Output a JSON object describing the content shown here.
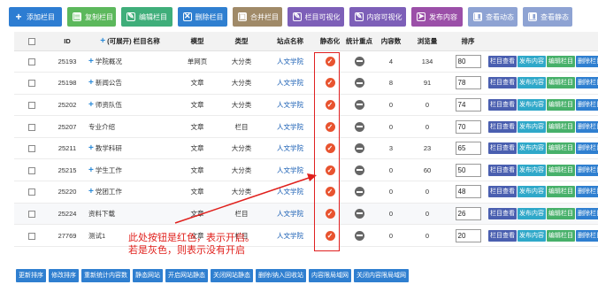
{
  "toolbar": [
    {
      "label": "添加栏目",
      "icon": "plus-icon",
      "glyph": "+",
      "color": "#2d7dd2",
      "w": 60
    },
    {
      "label": "复制栏目",
      "icon": "copy-icon",
      "glyph": "▤",
      "color": "#5cb85c",
      "w": 55
    },
    {
      "label": "编辑栏目",
      "icon": "edit-icon",
      "glyph": "✎",
      "color": "#3fae7a",
      "w": 58
    },
    {
      "label": "删除栏目",
      "icon": "delete-icon",
      "glyph": "✕",
      "color": "#2f7fd0",
      "w": 56
    },
    {
      "label": "合并栏目",
      "icon": "merge-icon",
      "glyph": "▣",
      "color": "#a08a68",
      "w": 56
    },
    {
      "label": "栏目可视化",
      "icon": "visual-icon",
      "glyph": "✎",
      "color": "#7d5fb8",
      "w": 64
    },
    {
      "label": "内容可视化",
      "icon": "content-visual-icon",
      "glyph": "✎",
      "color": "#7d5fb8",
      "w": 64
    },
    {
      "label": "发布内容",
      "icon": "publish-icon",
      "glyph": "➤",
      "color": "#9b4fa8",
      "w": 58
    },
    {
      "label": "查看动态",
      "icon": "view-dynamic-icon",
      "glyph": "◧",
      "color": "#8ea3d3",
      "w": 56
    },
    {
      "label": "查看静态",
      "icon": "view-static-icon",
      "glyph": "◧",
      "color": "#8ea3d3",
      "w": 56
    }
  ],
  "columns": [
    "",
    "ID",
    "(可展开) 栏目名称",
    "模型",
    "类型",
    "站点名称",
    "静态化",
    "统计重点",
    "内容数",
    "浏览量",
    "排序",
    ""
  ],
  "rows": [
    {
      "id": "25193",
      "expand": true,
      "name": "学院概况",
      "model": "单网页",
      "type": "大分类",
      "site": "人文学院",
      "static": true,
      "count": "4",
      "views": "134",
      "sort": "80"
    },
    {
      "id": "25198",
      "expand": true,
      "name": "新闻公告",
      "model": "文章",
      "type": "大分类",
      "site": "人文学院",
      "static": true,
      "count": "8",
      "views": "91",
      "sort": "78"
    },
    {
      "id": "25202",
      "expand": true,
      "name": "师资队伍",
      "model": "文章",
      "type": "大分类",
      "site": "人文学院",
      "static": true,
      "count": "0",
      "views": "0",
      "sort": "74"
    },
    {
      "id": "25207",
      "expand": false,
      "name": "专业介绍",
      "model": "文章",
      "type": "栏目",
      "site": "人文学院",
      "static": true,
      "count": "0",
      "views": "0",
      "sort": "70"
    },
    {
      "id": "25211",
      "expand": true,
      "name": "教学科研",
      "model": "文章",
      "type": "大分类",
      "site": "人文学院",
      "static": true,
      "count": "3",
      "views": "23",
      "sort": "65"
    },
    {
      "id": "25215",
      "expand": true,
      "name": "学生工作",
      "model": "文章",
      "type": "大分类",
      "site": "人文学院",
      "static": true,
      "count": "0",
      "views": "60",
      "sort": "50"
    },
    {
      "id": "25220",
      "expand": true,
      "name": "党团工作",
      "model": "文章",
      "type": "大分类",
      "site": "人文学院",
      "static": true,
      "count": "0",
      "views": "0",
      "sort": "48"
    },
    {
      "id": "25224",
      "expand": false,
      "name": "资料下载",
      "model": "文章",
      "type": "栏目",
      "site": "人文学院",
      "static": true,
      "count": "0",
      "views": "0",
      "sort": "26"
    },
    {
      "id": "27769",
      "expand": false,
      "name": "测试1",
      "model": "文章",
      "type": "栏目",
      "site": "人文学院",
      "static": true,
      "count": "0",
      "views": "0",
      "sort": "20"
    }
  ],
  "row_actions": [
    {
      "label": "栏目查看",
      "color": "#4a5fb0"
    },
    {
      "label": "发布内容",
      "color": "#2fa8c9"
    },
    {
      "label": "编辑栏目",
      "color": "#47b06a"
    },
    {
      "label": "删除栏目",
      "color": "#2f7fd0"
    }
  ],
  "annotation": {
    "line1": "此处按钮是红色，表示开启。",
    "line2": "若是灰色，则表示没有开启",
    "color": "#e0201c"
  },
  "bottom_buttons": [
    "更新排序",
    "修改排序",
    "重新统计内容数",
    "静态网站",
    "开启网站静态",
    "关闭网站静态",
    "删除/纳入回收站",
    "内容限局域网",
    "关闭内容限局域网"
  ]
}
